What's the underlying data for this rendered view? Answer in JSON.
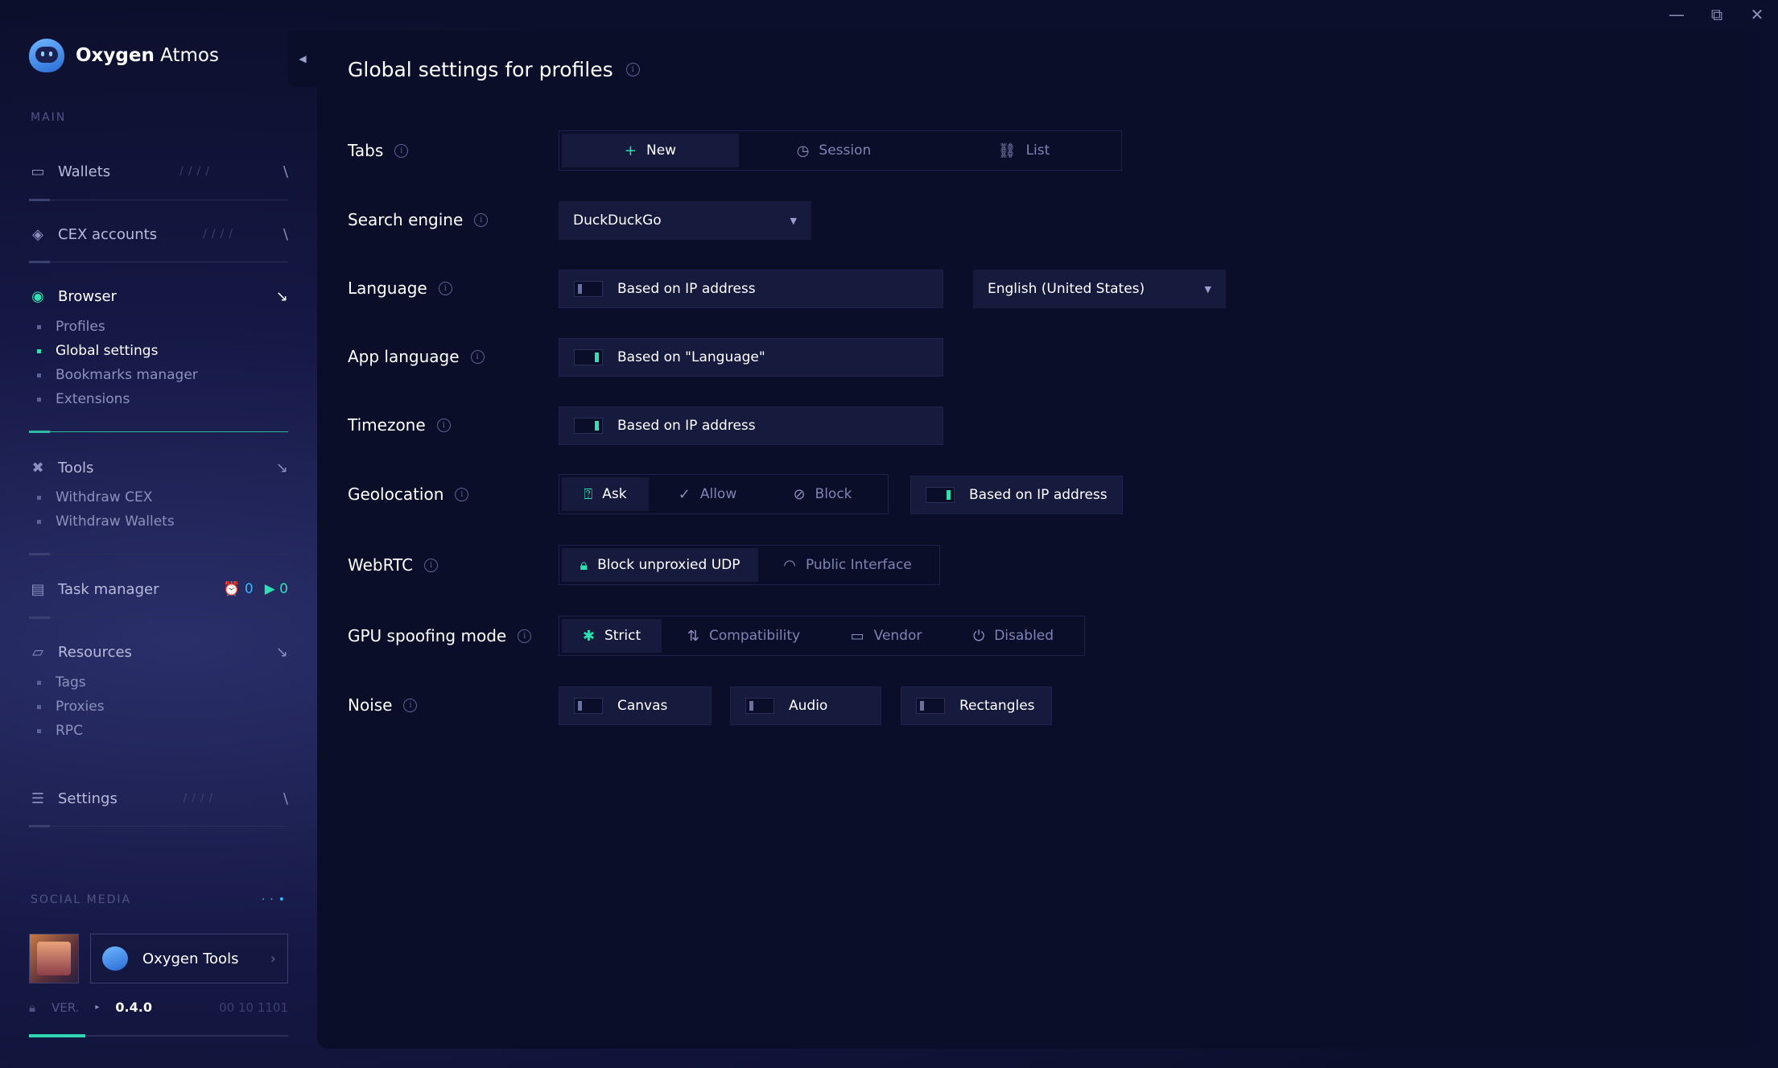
{
  "app": {
    "name_bold": "Oxygen",
    "name_light": " Atmos"
  },
  "window_controls": {
    "minimize": "—",
    "maximize": "⧉",
    "close": "✕"
  },
  "sidebar": {
    "main_label": "MAIN",
    "items": {
      "wallets": "Wallets",
      "cex": "CEX accounts",
      "browser": "Browser",
      "tools": "Tools",
      "task_manager": "Task manager",
      "resources": "Resources",
      "settings": "Settings"
    },
    "browser_sub": [
      "Profiles",
      "Global settings",
      "Bookmarks manager",
      "Extensions"
    ],
    "tools_sub": [
      "Withdraw CEX",
      "Withdraw Wallets"
    ],
    "resources_sub": [
      "Tags",
      "Proxies",
      "RPC"
    ],
    "task_counts": {
      "scheduled": "0",
      "running": "0"
    },
    "social_label": "SOCIAL MEDIA",
    "social_button": "Oxygen Tools",
    "version_label": "VER.",
    "version": "0.4.0",
    "version_code": "00 10 1101"
  },
  "page": {
    "title": "Global settings for profiles",
    "tabs": {
      "label": "Tabs",
      "options": [
        "New",
        "Session",
        "List"
      ],
      "selected": "New"
    },
    "search_engine": {
      "label": "Search engine",
      "value": "DuckDuckGo"
    },
    "language": {
      "label": "Language",
      "toggle_text": "Based on IP address",
      "toggle_on": false,
      "select_value": "English (United States)"
    },
    "app_language": {
      "label": "App language",
      "toggle_text": "Based on \"Language\"",
      "toggle_on": true
    },
    "timezone": {
      "label": "Timezone",
      "toggle_text": "Based on IP address",
      "toggle_on": true
    },
    "geolocation": {
      "label": "Geolocation",
      "options": [
        "Ask",
        "Allow",
        "Block"
      ],
      "selected": "Ask",
      "toggle_text": "Based on IP address",
      "toggle_on": true
    },
    "webrtc": {
      "label": "WebRTC",
      "options": [
        "Block unproxied UDP",
        "Public Interface"
      ],
      "selected": "Block unproxied UDP"
    },
    "gpu": {
      "label": "GPU spoofing mode",
      "options": [
        "Strict",
        "Compatibility",
        "Vendor",
        "Disabled"
      ],
      "selected": "Strict"
    },
    "noise": {
      "label": "Noise",
      "options": [
        "Canvas",
        "Audio",
        "Rectangles"
      ]
    }
  },
  "colors": {
    "accent": "#2fe0b0",
    "background": "#0b0e28",
    "control": "#161a3d"
  }
}
